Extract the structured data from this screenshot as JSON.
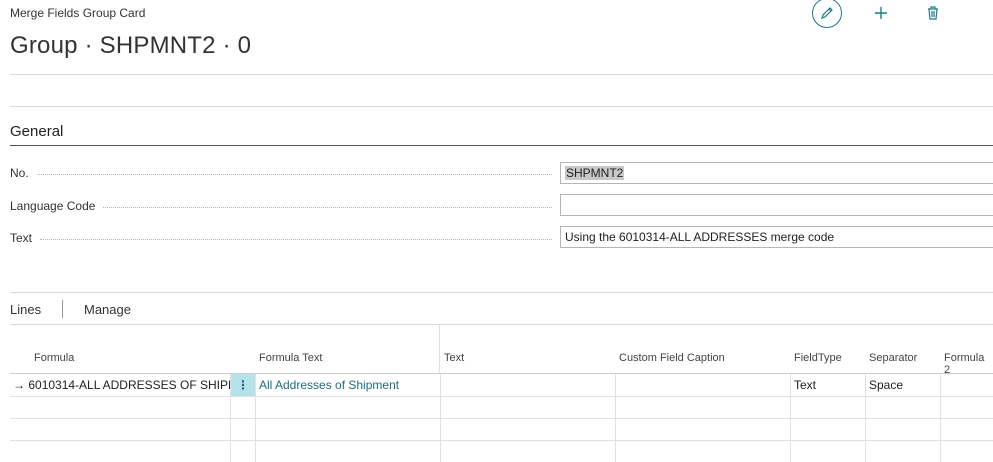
{
  "header": {
    "caption": "Merge Fields Group Card",
    "title": "Group · SHPMNT2 · 0",
    "actions": {
      "edit_icon": "pencil-icon",
      "new_icon": "plus-icon",
      "delete_icon": "trash-icon"
    }
  },
  "general": {
    "title": "General",
    "fields": [
      {
        "label": "No.",
        "value": "SHPMNT2"
      },
      {
        "label": "Language Code",
        "value": ""
      },
      {
        "label": "Text",
        "value": "Using the 6010314-ALL ADDRESSES merge code"
      }
    ]
  },
  "lines": {
    "tabs": [
      "Lines",
      "Manage"
    ],
    "columns": [
      "Formula",
      "Formula Text",
      "Text",
      "Custom Field Caption",
      "FieldType",
      "Separator",
      "Formula 2"
    ],
    "rows": [
      {
        "formula": "6010314-ALL ADDRESSES OF SHIPM...",
        "formula_text": "All Addresses of Shipment",
        "text": "",
        "custom_caption": "",
        "field_type": "Text",
        "separator": "Space",
        "formula2": ""
      }
    ],
    "colors": {
      "accent": "#1b6e79",
      "selected_cell": "#b4e3ea"
    }
  }
}
